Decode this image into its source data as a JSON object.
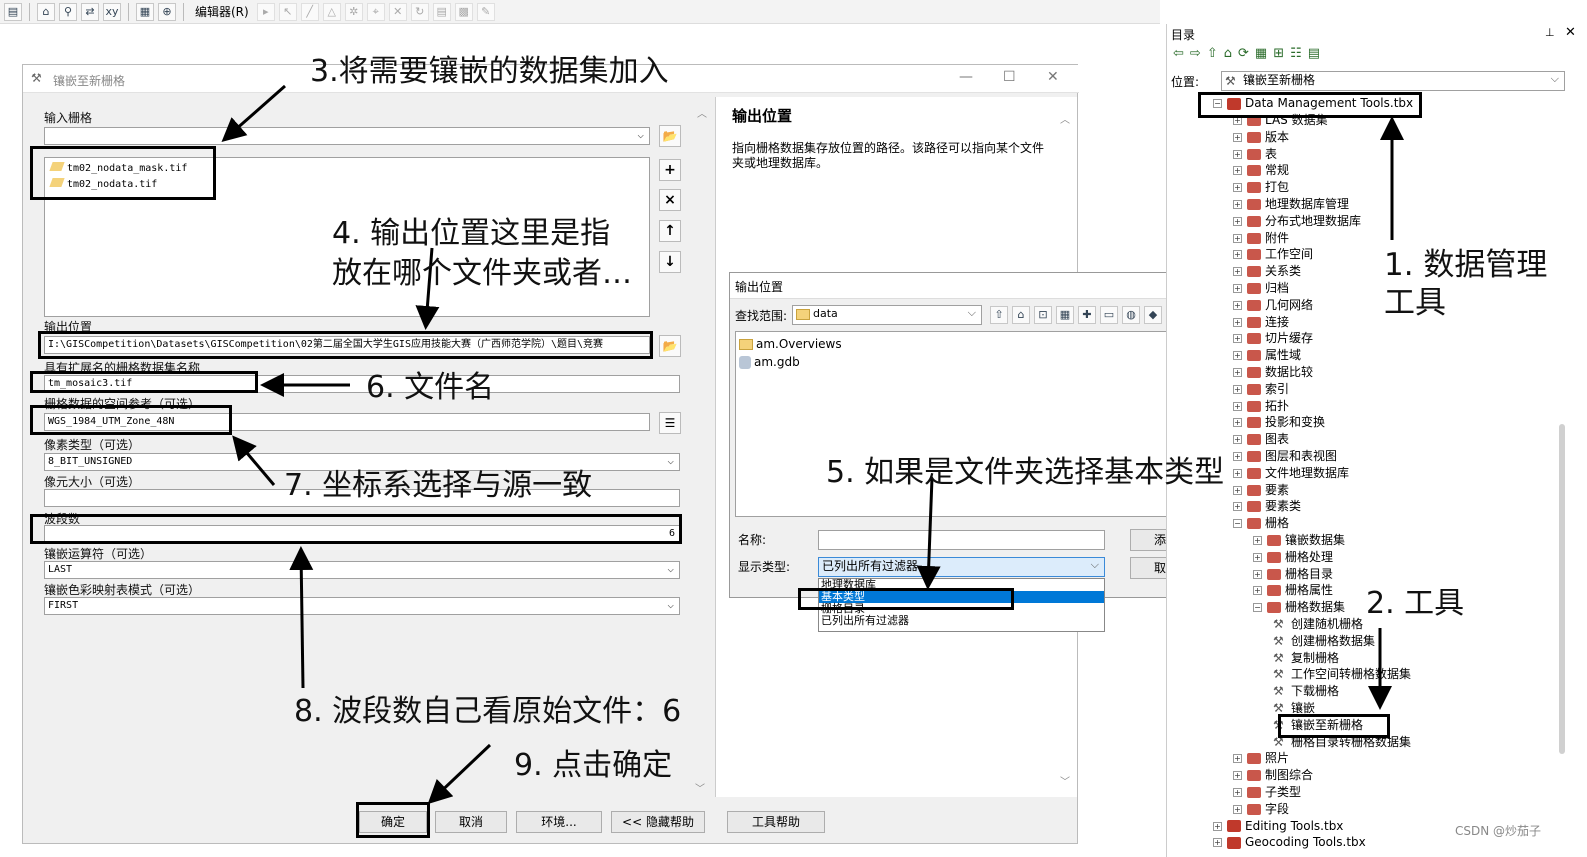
{
  "toolbar": {
    "editor_menu": "编辑器(R)"
  },
  "dialog": {
    "title": "镶嵌至新栅格",
    "input_rasters_label": "输入栅格",
    "input_files": [
      "tm02_nodata_mask.tif",
      "tm02_nodata.tif"
    ],
    "output_location_label": "输出位置",
    "output_location_value": "I:\\GISCompetition\\Datasets\\GISCompetition\\02第二届全国大学生GIS应用技能大赛（广西师范学院）\\题目\\竞赛",
    "dataset_name_label": "具有扩展名的栅格数据集名称",
    "dataset_name_value": "tm_mosaic3.tif",
    "spatial_ref_label": "栅格数据的空间参考（可选）",
    "spatial_ref_value": "WGS_1984_UTM_Zone_48N",
    "pixel_type_label": "像素类型（可选）",
    "pixel_type_value": "8_BIT_UNSIGNED",
    "cell_size_label": "像元大小（可选）",
    "bands_label": "波段数",
    "bands_value": "6",
    "mosaic_op_label": "镶嵌运算符（可选）",
    "mosaic_op_value": "LAST",
    "colormap_label": "镶嵌色彩映射表模式（可选）",
    "colormap_value": "FIRST",
    "help_title": "输出位置",
    "help_text": "指向栅格数据集存放位置的路径。该路径可以指向某个文件夹或地理数据库。",
    "buttons": {
      "ok": "确定",
      "cancel": "取消",
      "env": "环境...",
      "hide_help": "<< 隐藏帮助",
      "tool_help": "工具帮助"
    }
  },
  "subdialog": {
    "title": "输出位置",
    "look_in_label": "查找范围:",
    "look_in_value": "data",
    "items": [
      "am.Overviews",
      "am.gdb"
    ],
    "name_label": "名称:",
    "type_label": "显示类型:",
    "type_value": "已列出所有过滤器",
    "type_options": [
      "地理数据库",
      "基本类型",
      "栅格目录",
      "已列出所有过滤器"
    ],
    "add_button": "添加",
    "cancel_button": "取消"
  },
  "catalog": {
    "title": "目录",
    "location_label": "位置:",
    "location_value": "镶嵌至新栅格",
    "root": "Data Management Tools.tbx",
    "toolsets": [
      "LAS 数据集",
      "版本",
      "表",
      "常规",
      "打包",
      "地理数据库管理",
      "分布式地理数据库",
      "附件",
      "工作空间",
      "关系类",
      "归档",
      "几何网络",
      "连接",
      "切片缓存",
      "属性域",
      "数据比较",
      "索引",
      "拓扑",
      "投影和变换",
      "图表",
      "图层和表视图",
      "文件地理数据库",
      "要素",
      "要素类"
    ],
    "raster": "栅格",
    "raster_children": [
      "镶嵌数据集",
      "栅格处理",
      "栅格目录",
      "栅格属性"
    ],
    "raster_dataset": "栅格数据集",
    "raster_dataset_tools": [
      "创建随机栅格",
      "创建栅格数据集",
      "复制栅格",
      "工作空间转栅格数据集",
      "下载栅格",
      "镶嵌",
      "镶嵌至新栅格",
      "栅格目录转栅格数据集"
    ],
    "after": [
      "照片",
      "制图综合",
      "子类型",
      "字段"
    ],
    "more_tbx": [
      "Editing Tools.tbx",
      "Geocoding Tools.tbx"
    ]
  },
  "annotations": {
    "n1": "1. 数据管理\n工具",
    "n2": "2. 工具",
    "n3": "3.将需要镶嵌的数据集加入",
    "n4": "4. 输出位置这里是指\n放在哪个文件夹或者…",
    "n5": "5. 如果是文件夹选择基本类型",
    "n6": "6. 文件名",
    "n7": "7. 坐标系选择与源一致",
    "n8": "8. 波段数自己看原始文件：6",
    "n9": "9. 点击确定"
  },
  "watermark": "CSDN @炒茄子"
}
